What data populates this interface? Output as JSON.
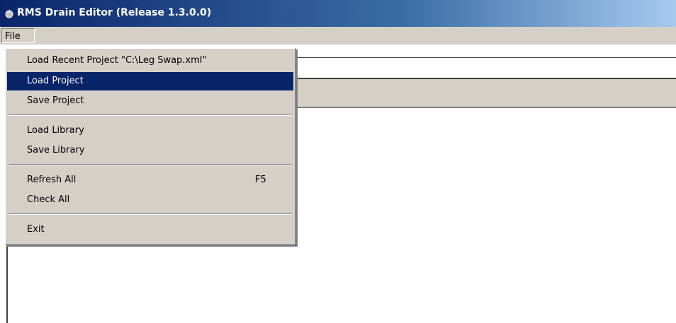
{
  "window": {
    "title": "RMS Drain Editor (Release 1.3.0.0)",
    "icon": "app-icon"
  },
  "menubar": {
    "items": [
      {
        "label": "File"
      }
    ]
  },
  "file_menu": {
    "items": [
      {
        "label": "Load Recent Project \"C:\\Leg Swap.xml\"",
        "shortcut": ""
      },
      {
        "label": "Load Project",
        "shortcut": "",
        "selected": true
      },
      {
        "label": "Save Project",
        "shortcut": ""
      },
      {
        "label": "Load Library",
        "shortcut": ""
      },
      {
        "label": "Save Library",
        "shortcut": ""
      },
      {
        "label": "Refresh All",
        "shortcut": "F5"
      },
      {
        "label": "Check All",
        "shortcut": ""
      },
      {
        "label": "Exit",
        "shortcut": ""
      }
    ]
  },
  "colors": {
    "title_bar": "#0a246a",
    "menu_bg": "#d4d0c8",
    "selection": "#0a246a"
  }
}
